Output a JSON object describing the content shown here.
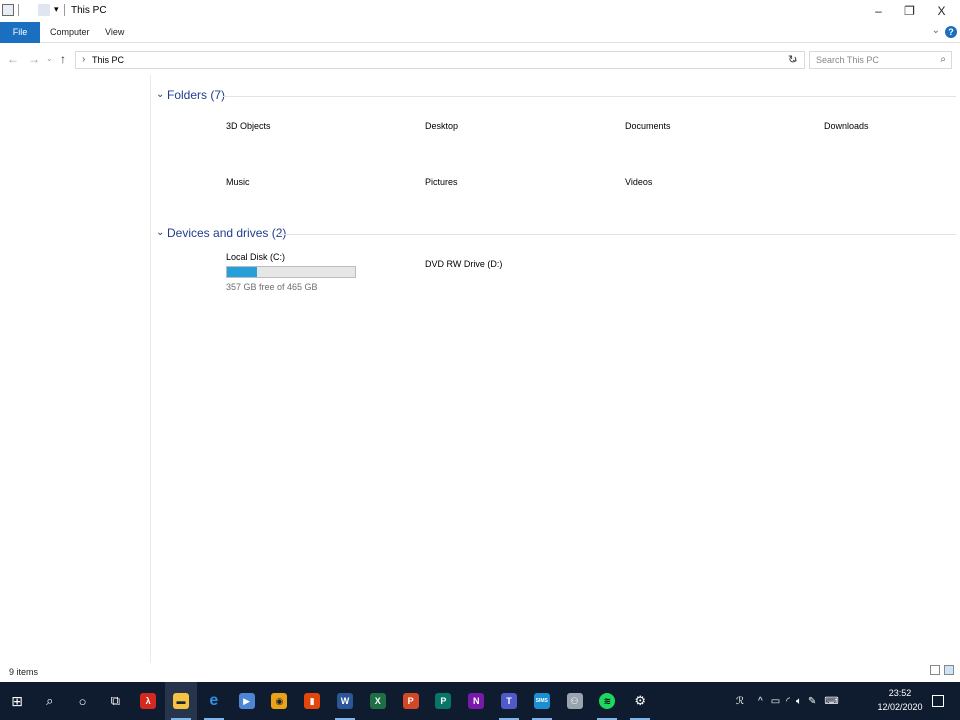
{
  "window": {
    "title": "This PC",
    "controls": {
      "minimize": "–",
      "restore": "❐",
      "close": "X"
    }
  },
  "ribbon": {
    "tabs": [
      "File",
      "Computer",
      "View"
    ]
  },
  "address": {
    "breadcrumb": "This PC",
    "search_placeholder": "Search This PC"
  },
  "groups": {
    "folders": {
      "title": "Folders (7)",
      "items": [
        "3D Objects",
        "Desktop",
        "Documents",
        "Downloads",
        "Music",
        "Pictures",
        "Videos"
      ]
    },
    "drives": {
      "title": "Devices and drives (2)",
      "items": [
        {
          "name": "Local Disk (C:)",
          "free_text": "357 GB free of 465 GB",
          "used_fraction": 0.232
        },
        {
          "name": "DVD RW Drive (D:)"
        }
      ]
    }
  },
  "status": {
    "items_count": "9 items"
  },
  "taskbar": {
    "apps": [
      {
        "name": "start-icon"
      },
      {
        "name": "search-icon"
      },
      {
        "name": "cortana-icon"
      },
      {
        "name": "task-view-icon"
      },
      {
        "name": "acrobat-icon",
        "color": "#d4291f"
      },
      {
        "name": "file-explorer-icon",
        "color": "#f5c242"
      },
      {
        "name": "edge-icon",
        "color": "#2f8fe0"
      },
      {
        "name": "media-app-icon",
        "color": "#4e86d6"
      },
      {
        "name": "chrome-icon",
        "color": "#e8a317"
      },
      {
        "name": "office-icon",
        "color": "#e3450b"
      },
      {
        "name": "word-icon",
        "color": "#2b5797"
      },
      {
        "name": "excel-icon",
        "color": "#1d7044"
      },
      {
        "name": "powerpoint-icon",
        "color": "#d24726"
      },
      {
        "name": "publisher-icon",
        "color": "#077568"
      },
      {
        "name": "onenote-icon",
        "color": "#7719aa"
      },
      {
        "name": "teams-icon",
        "color": "#5059c9"
      },
      {
        "name": "sims-icon",
        "color": "#1b8fd1"
      },
      {
        "name": "people-app-icon",
        "color": "#9aa4b1"
      },
      {
        "name": "spotify-icon",
        "color": "#1ed760"
      },
      {
        "name": "settings-icon",
        "color": "#ffffff"
      }
    ],
    "glyphs": {
      "word": "W",
      "excel": "X",
      "powerpoint": "P",
      "publisher": "P",
      "onenote": "N",
      "teams": "T",
      "sims": "SIMS"
    },
    "clock": {
      "time": "23:52",
      "date": "12/02/2020"
    }
  }
}
